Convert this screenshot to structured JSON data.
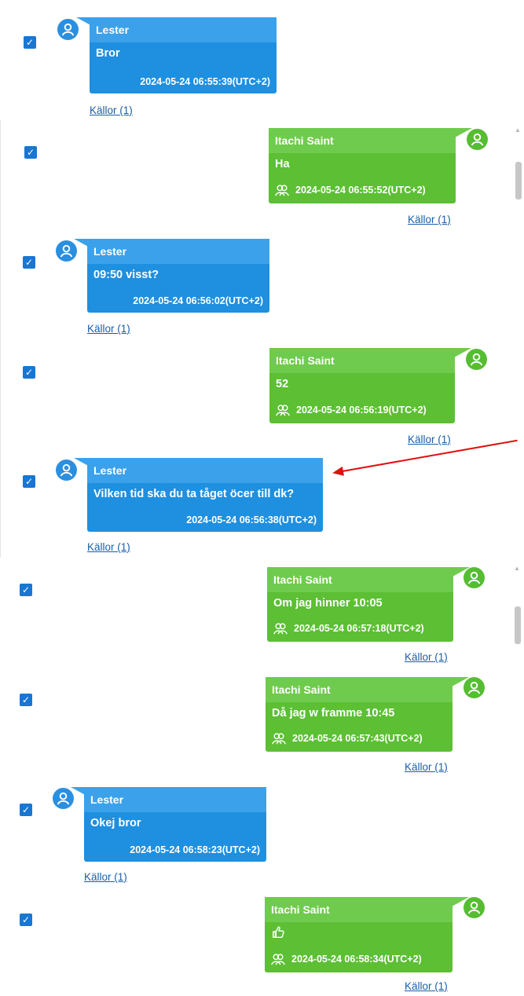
{
  "sources_label": "Källor (1)",
  "colors": {
    "incoming": "#1f8fdf",
    "outgoing": "#5cbf34",
    "checkbox": "#1976d2",
    "link": "#1a5ea8",
    "annotation_arrow": "#e01010"
  },
  "messages": [
    {
      "sender": "Lester",
      "text": "Bror",
      "time": "2024-05-24 06:55:39(UTC+2)",
      "direction": "in",
      "checked": true
    },
    {
      "sender": "Itachi Saint",
      "text": "Ha",
      "time": "2024-05-24 06:55:52(UTC+2)",
      "direction": "out",
      "checked": true
    },
    {
      "sender": "Lester",
      "text": "09:50 visst?",
      "time": "2024-05-24 06:56:02(UTC+2)",
      "direction": "in",
      "checked": true
    },
    {
      "sender": "Itachi Saint",
      "text": "52",
      "time": "2024-05-24 06:56:19(UTC+2)",
      "direction": "out",
      "checked": true
    },
    {
      "sender": "Lester",
      "text": "Vilken tid ska du ta tåget öcer till dk?",
      "time": "2024-05-24 06:56:38(UTC+2)",
      "direction": "in",
      "checked": true
    },
    {
      "sender": "Itachi Saint",
      "text": "Om jag hinner 10:05",
      "time": "2024-05-24 06:57:18(UTC+2)",
      "direction": "out",
      "checked": true
    },
    {
      "sender": "Itachi Saint",
      "text": "Då jag w framme 10:45",
      "time": "2024-05-24 06:57:43(UTC+2)",
      "direction": "out",
      "checked": true
    },
    {
      "sender": "Lester",
      "text": "Okej bror",
      "time": "2024-05-24 06:58:23(UTC+2)",
      "direction": "in",
      "checked": true
    },
    {
      "sender": "Itachi Saint",
      "text": "",
      "emoji_icon": "thumbs-up-icon",
      "time": "2024-05-24 06:58:34(UTC+2)",
      "direction": "out",
      "checked": true
    }
  ]
}
